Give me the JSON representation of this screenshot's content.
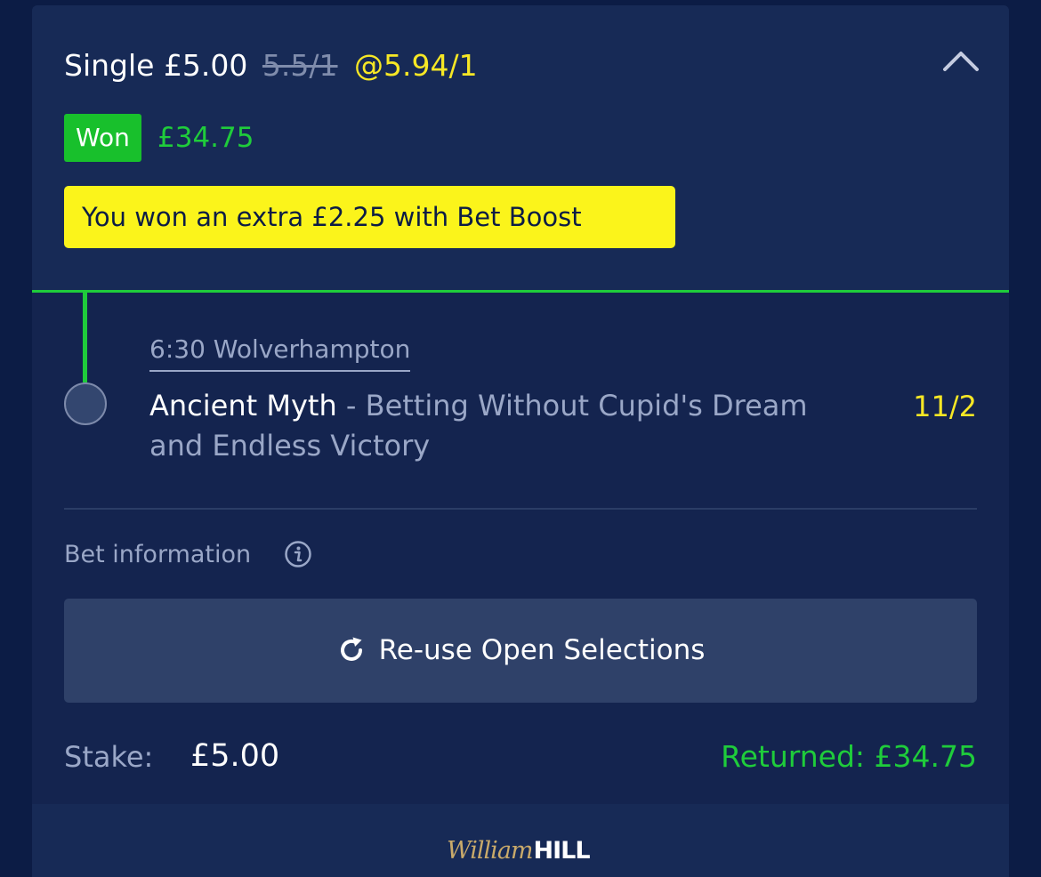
{
  "bet": {
    "title_prefix": "Single £5.00",
    "original_odds": "5.5/1",
    "boosted_odds": "@5.94/1",
    "status_label": "Won",
    "won_amount": "£34.75",
    "boost_message": "You won an extra £2.25 with Bet Boost"
  },
  "selection": {
    "event_name": "6:30 Wolverhampton",
    "runner_name": "Ancient Myth",
    "market": " - Betting Without Cupid's Dream and Endless Victory",
    "odds": "11/2"
  },
  "info": {
    "label": "Bet information",
    "icon": "info-icon"
  },
  "actions": {
    "reuse_label": "Re-use Open Selections",
    "reuse_icon": "refresh-icon",
    "collapse_icon": "chevron-up-icon"
  },
  "summary": {
    "stake_label": "Stake:",
    "stake_value": "£5.00",
    "returned": "Returned: £34.75"
  },
  "footer": {
    "logo_script": "William",
    "logo_block": "HILL"
  },
  "colors": {
    "background": "#0c1c45",
    "card": "#14244f",
    "win_green": "#1fcc3b",
    "boost_yellow": "#fbf41b",
    "odds_yellow": "#f6e725",
    "muted_text": "#9aa7c7",
    "button": "#2f4169"
  }
}
